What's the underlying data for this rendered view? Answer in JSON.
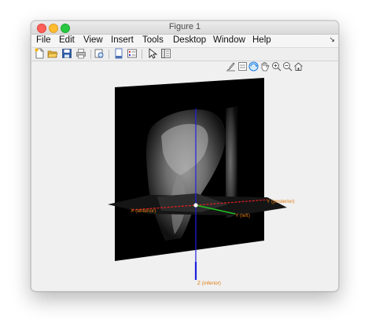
{
  "window": {
    "title": "Figure 1"
  },
  "menu": [
    "File",
    "Edit",
    "View",
    "Insert",
    "Tools",
    "Desktop",
    "Window",
    "Help"
  ],
  "menu_overflow": "↘",
  "toolbar": {
    "icons": [
      "new-figure-icon",
      "open-file-icon",
      "save-icon",
      "print-icon",
      "print-preview-icon",
      "link-plot-icon",
      "insert-colorbar-icon",
      "edit-plot-icon",
      "plot-browser-icon"
    ]
  },
  "axes_toolbar": {
    "icons": [
      "brush-icon",
      "data-tips-icon",
      "rotate-3d-icon",
      "pan-icon",
      "zoom-in-icon",
      "zoom-out-icon",
      "restore-view-icon"
    ]
  },
  "plot": {
    "axis_labels": {
      "x": "X (anterior)",
      "y_posterior": "Y (posterior)",
      "y_left": "Y (left)",
      "z": "Z (inferior)"
    },
    "colors": {
      "x_axis": "#e02020",
      "y_axis": "#20c020",
      "z_axis": "#2020e0",
      "label": "#e07a10",
      "slice": "#000000"
    }
  }
}
